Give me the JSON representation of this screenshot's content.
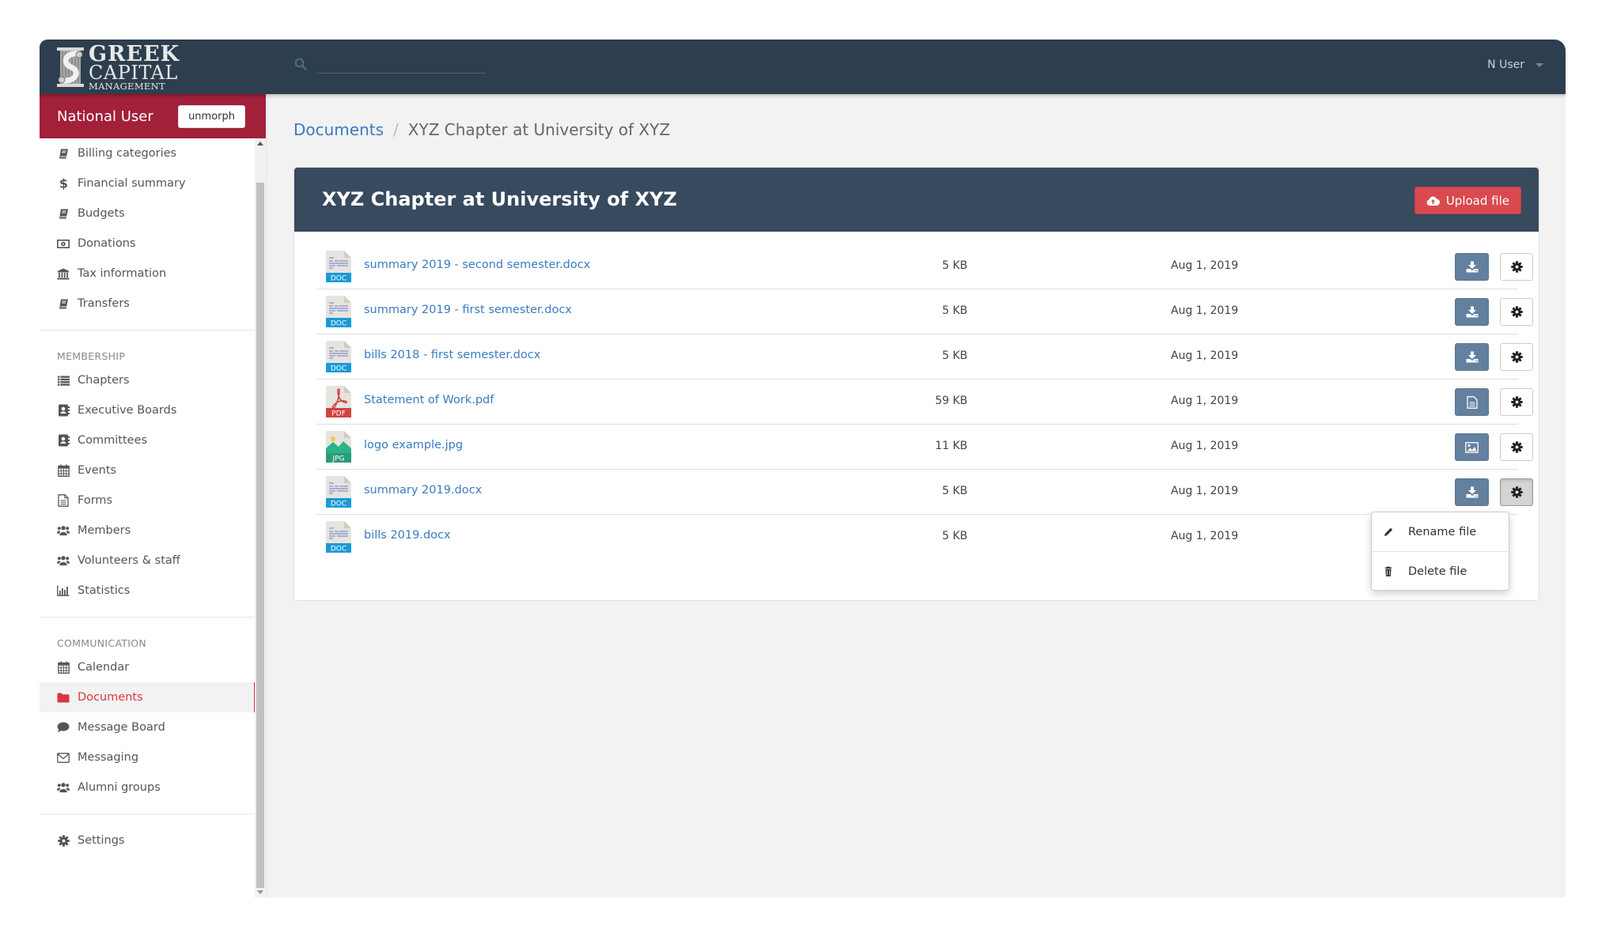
{
  "app": {
    "logo_lines": [
      "GREEK",
      "CAPITAL",
      "MANAGEMENT"
    ],
    "search_placeholder": "",
    "user_menu_label": "N User"
  },
  "sidebar": {
    "user_name": "National User",
    "unmorph_label": "unmorph",
    "groups": [
      {
        "title": "",
        "items": [
          {
            "label": "Billing categories",
            "icon": "book-icon"
          },
          {
            "label": "Financial summary",
            "icon": "dollar-icon"
          },
          {
            "label": "Budgets",
            "icon": "book-icon"
          },
          {
            "label": "Donations",
            "icon": "money-icon"
          },
          {
            "label": "Tax information",
            "icon": "bank-icon"
          },
          {
            "label": "Transfers",
            "icon": "book-icon"
          }
        ]
      },
      {
        "title": "MEMBERSHIP",
        "items": [
          {
            "label": "Chapters",
            "icon": "list-icon"
          },
          {
            "label": "Executive Boards",
            "icon": "contact-book-icon"
          },
          {
            "label": "Committees",
            "icon": "contact-book-icon"
          },
          {
            "label": "Events",
            "icon": "calendar-icon"
          },
          {
            "label": "Forms",
            "icon": "file-text-icon"
          },
          {
            "label": "Members",
            "icon": "users-icon"
          },
          {
            "label": "Volunteers & staff",
            "icon": "users-icon"
          },
          {
            "label": "Statistics",
            "icon": "bar-chart-icon"
          }
        ]
      },
      {
        "title": "COMMUNICATION",
        "items": [
          {
            "label": "Calendar",
            "icon": "calendar-icon"
          },
          {
            "label": "Documents",
            "icon": "folder-icon",
            "active": true
          },
          {
            "label": "Message Board",
            "icon": "comment-icon"
          },
          {
            "label": "Messaging",
            "icon": "envelope-icon"
          },
          {
            "label": "Alumni groups",
            "icon": "users-icon"
          }
        ]
      },
      {
        "title": "",
        "items": [
          {
            "label": "Settings",
            "icon": "gear-icon"
          }
        ]
      }
    ]
  },
  "breadcrumb": {
    "root": "Documents",
    "separator": "/",
    "current": "XYZ Chapter at University of XYZ"
  },
  "card": {
    "title": "XYZ Chapter at University of XYZ",
    "upload_label": "Upload file"
  },
  "files": [
    {
      "name": "summary 2019 - second semester.docx",
      "type": "DOC",
      "size": "5 KB",
      "date": "Aug 1, 2019",
      "action": "download"
    },
    {
      "name": "summary 2019 - first semester.docx",
      "type": "DOC",
      "size": "5 KB",
      "date": "Aug 1, 2019",
      "action": "download"
    },
    {
      "name": "bills 2018 - first semester.docx",
      "type": "DOC",
      "size": "5 KB",
      "date": "Aug 1, 2019",
      "action": "download"
    },
    {
      "name": "Statement of Work.pdf",
      "type": "PDF",
      "size": "59 KB",
      "date": "Aug 1, 2019",
      "action": "view-document"
    },
    {
      "name": "logo example.jpg",
      "type": "JPG",
      "size": "11 KB",
      "date": "Aug 1, 2019",
      "action": "view-image"
    },
    {
      "name": "summary 2019.docx",
      "type": "DOC",
      "size": "5 KB",
      "date": "Aug 1, 2019",
      "action": "download",
      "menu_open": true
    },
    {
      "name": "bills 2019.docx",
      "type": "DOC",
      "size": "5 KB",
      "date": "Aug 1, 2019",
      "action": "download",
      "hidden_actions": true
    }
  ],
  "file_menu": {
    "items": [
      {
        "label": "Rename file",
        "icon": "pencil-icon"
      },
      {
        "label": "Delete file",
        "icon": "trash-icon"
      }
    ]
  },
  "colors": {
    "topbar": "#2d3e4e",
    "brand_red": "#a2203a",
    "card_header": "#374a5e",
    "upload_button": "#d84a4f",
    "action_button": "#63809f",
    "link": "#3a7bbf",
    "active_nav": "#d9363e",
    "doc_badge": "#1a9ad6",
    "pdf_badge": "#d0443f",
    "jpg_badge": "#2a9c78"
  }
}
